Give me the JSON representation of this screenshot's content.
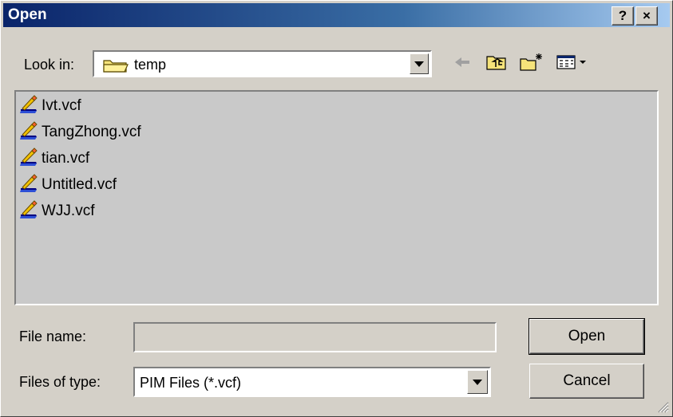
{
  "window": {
    "title": "Open",
    "help_label": "?",
    "close_label": "×"
  },
  "lookin": {
    "label": "Look in:",
    "value": "temp"
  },
  "toolbar": {
    "icons": [
      "back-arrow-icon",
      "up-folder-icon",
      "new-folder-icon",
      "view-menu-icon"
    ]
  },
  "files": [
    {
      "name": "Ivt.vcf"
    },
    {
      "name": "TangZhong.vcf"
    },
    {
      "name": "tian.vcf"
    },
    {
      "name": "Untitled.vcf"
    },
    {
      "name": "WJJ.vcf"
    }
  ],
  "filename": {
    "label": "File name:",
    "value": ""
  },
  "filetype": {
    "label": "Files of type:",
    "value": "PIM Files (*.vcf)"
  },
  "buttons": {
    "open": "Open",
    "cancel": "Cancel"
  },
  "colors": {
    "titlebar_start": "#0a246a",
    "titlebar_end": "#a6caf0",
    "face": "#d4d0c8",
    "list_bg": "#c9c9c9"
  }
}
